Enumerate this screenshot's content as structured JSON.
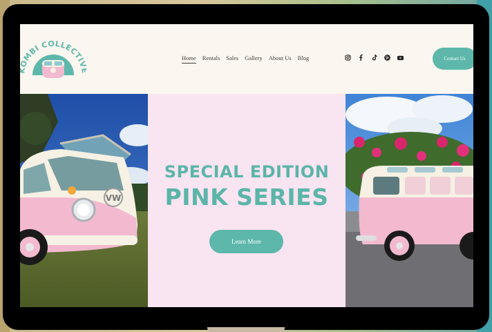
{
  "brand": {
    "name": "KOMBI COLLECTIVE"
  },
  "nav": {
    "items": [
      {
        "label": "Home",
        "active": true
      },
      {
        "label": "Rentals"
      },
      {
        "label": "Sales"
      },
      {
        "label": "Gallery"
      },
      {
        "label": "About Us"
      },
      {
        "label": "Blog"
      }
    ]
  },
  "socials": [
    "instagram-icon",
    "facebook-icon",
    "tiktok-icon",
    "pinterest-icon",
    "youtube-icon"
  ],
  "header": {
    "contact_label": "Contact Us"
  },
  "hero": {
    "line1": "SPECIAL EDITION",
    "line2": "PINK SERIES",
    "cta_label": "Learn More"
  },
  "colors": {
    "accent": "#5db8ab",
    "hero_bg": "#f9e4f1",
    "page_bg": "#fbf6ef",
    "bus_pink": "#f2b9cf"
  }
}
